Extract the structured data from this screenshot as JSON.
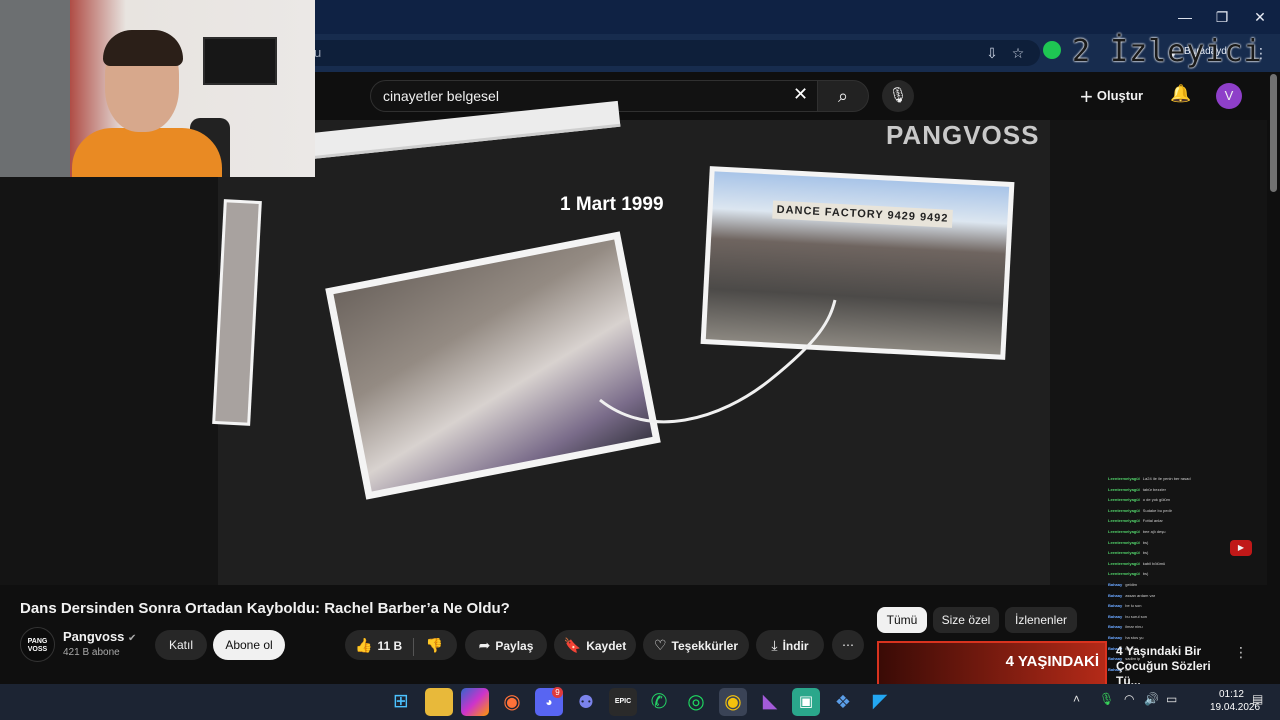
{
  "browser": {
    "url_text": "u",
    "profile_label": "Buradaydı",
    "viewer_overlay": "2 İzleyici"
  },
  "youtube": {
    "search": {
      "value": "cinayetler belgesel"
    },
    "create_label": "Oluştur",
    "avatar_letter": "V"
  },
  "video_frame": {
    "brand": "PANGVOSS",
    "date": "1 Mart 1999",
    "shop_sign": "DANCE FACTORY  9429 9492"
  },
  "video": {
    "title": "Dans Dersinden Sonra Ortadan Kayboldu: Rachel Barber’a Ne Oldu?",
    "channel": {
      "name": "Pangvoss",
      "subscribers": "421 B abone",
      "logo_text": "PANG VOSS"
    },
    "join_label": "Katıl",
    "subscribe_label": "Abone ol",
    "likes": "11 B",
    "share_label": "Paylaş",
    "save_label": "Kaydet",
    "thanks_label": "Teşekkürler",
    "download_label": "İndir"
  },
  "chips": [
    "Tümü",
    "Size özel",
    "İzlenenler"
  ],
  "recommended": {
    "thumb_text": "4 YAŞINDAKİ",
    "title": "4 Yaşındaki Bir Çocuğun Sözleri Tü..."
  },
  "chat_lines": [
    {
      "user": "Leentermelyagül",
      "text": "La24 ile ile yenin ber rasad"
    },
    {
      "user": "Leentermelyagül",
      "text": "tabür bezzler"
    },
    {
      "user": "Leentermelyagül",
      "text": "o de yok gülüm"
    },
    {
      "user": "Leentermelyagül",
      "text": "Sudake bu pedir"
    },
    {
      "user": "Leentermelyagül",
      "text": "Fottal anlar"
    },
    {
      "user": "Leentermelyagül",
      "text": "bee ajlı deşu"
    },
    {
      "user": "Leentermelyagül",
      "text": "bs)"
    },
    {
      "user": "Leentermelyagül",
      "text": "bs)"
    },
    {
      "user": "Leentermelyagül",
      "text": "kabil bölümü"
    },
    {
      "user": "Leentermelyagül",
      "text": "bs)"
    },
    {
      "user": "Bahaay",
      "text": "geldim"
    },
    {
      "user": "Bahaay",
      "text": "assan ardam var"
    },
    {
      "user": "Bahaay",
      "text": "be lu son"
    },
    {
      "user": "Bahaay",
      "text": "bu surul son"
    },
    {
      "user": "Bahaay",
      "text": "ilmar ninu"
    },
    {
      "user": "Bahaay",
      "text": "ha stos yu"
    },
    {
      "user": "Bahaay",
      "text": "işlemsi"
    },
    {
      "user": "Bahaay",
      "text": "sadim ip"
    },
    {
      "user": "Bahaay",
      "text": "ok"
    }
  ],
  "taskbar": {
    "time": "01:12",
    "date": "19.04.2026",
    "discord_badge": "9",
    "epic_label": "EPIC"
  },
  "colors": {
    "youtube_bg": "#0f0f0f",
    "titlebar": "#0f2244",
    "taskbar": "#1c2433",
    "avatar": "#8e3fc9",
    "chat_user": "#52d46b"
  }
}
